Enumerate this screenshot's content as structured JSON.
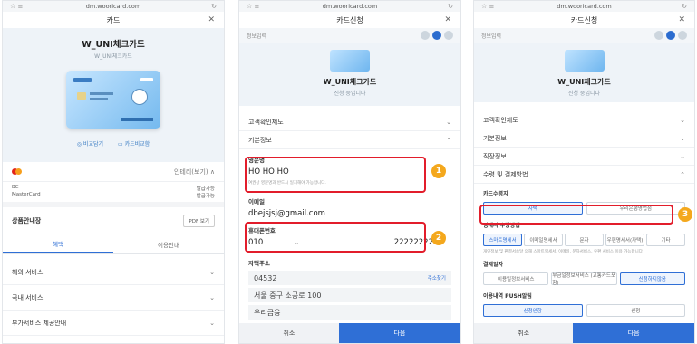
{
  "browser": {
    "url": "dm.wooricard.com",
    "left_icon": "☆ ≡",
    "right_icon": "↻"
  },
  "panel1": {
    "header_title": "카드",
    "close": "✕",
    "card_name": "W_UNI체크카드",
    "card_sub": "W_UNI체크카드",
    "link_left": "◎ 비교담기",
    "link_right": "▭ 카드비교함",
    "brand_label": "인테리(보기) ∧",
    "benefits": [
      {
        "label": "BC",
        "value": "발급가능"
      },
      {
        "label": "MasterCard",
        "value": "발급가능"
      }
    ],
    "product_info": "상품안내장",
    "pdf_button": "PDF 보기",
    "tab_benefit": "혜택",
    "tab_usage": "이용안내",
    "menu_items": [
      "해외 서비스",
      "국내 서비스",
      "부가서비스 제공안내"
    ]
  },
  "panel2": {
    "header_title": "카드신청",
    "step_label": "정보입력",
    "card_name": "W_UNI체크카드",
    "card_sub": "신청 중입니다",
    "section_customer": "고객확인제도",
    "section_basic": "기본정보",
    "eng_name_label": "영문명",
    "eng_name_value": "HO HO HO",
    "eng_name_note": "여권상 영문명과 반드시 일치해야 가능합니다.",
    "email_label": "이메일",
    "email_value": "dbejsjsj@gmail.com",
    "phone_label": "휴대폰번호",
    "phone_prefix": "010",
    "phone_number": "22222222",
    "addr_label": "자택주소",
    "zip": "04532",
    "zip_btn": "주소찾기",
    "addr1": "서울 중구 소공로 100",
    "addr2": "우리금융",
    "cancel": "취소",
    "next": "다음",
    "badge1": "1",
    "badge2": "2"
  },
  "panel3": {
    "header_title": "카드신청",
    "step_label": "정보입력",
    "card_name": "W_UNI체크카드",
    "card_sub": "신청 중입니다",
    "sections": [
      "고객확인제도",
      "기본정보",
      "직장정보",
      "수령 및 결제방법"
    ],
    "receive_label": "카드수령지",
    "receive_home": "자택",
    "receive_branch": "우리은행영업점",
    "statement_label": "명세서 수령방법",
    "statement_opts": [
      "스마트명세서",
      "이메일명세서",
      "문자",
      "우편명세서(자택)",
      "기타"
    ],
    "statement_note": "개인정보 및 판결서송달 의해 스마트명세서, 이메일, 문자서비스, 우편 서비스 이용 가능합니다",
    "payment_label": "결제일자",
    "payment_opts": [
      "이용일정보서비스",
      "부금일정보서비스 (교통카드포함)",
      "신청하지않음"
    ],
    "push_label": "이용내역 PUSH알림",
    "push_opts": [
      "신청안함",
      "신청"
    ],
    "cancel": "취소",
    "next": "다음",
    "badge3": "3"
  }
}
